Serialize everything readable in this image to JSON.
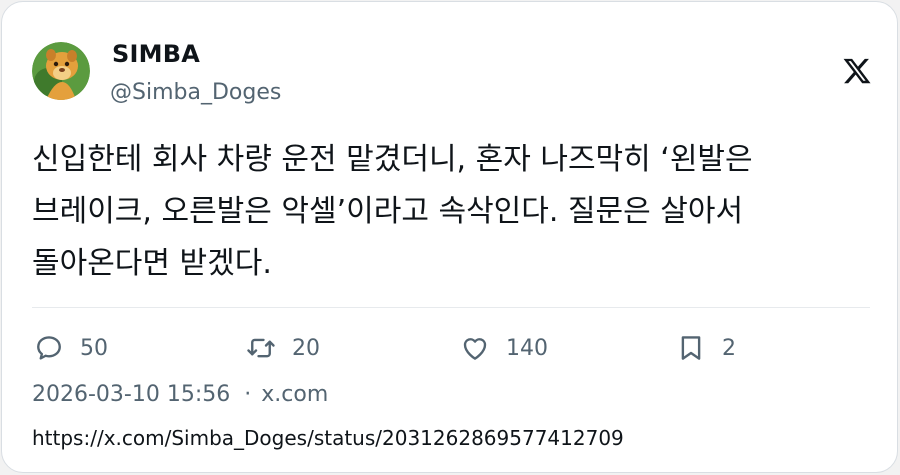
{
  "tweet": {
    "author_name": "SIMBA",
    "author_handle": "@Simba_Doges",
    "text": "신입한테 회사 차량 운전 맡겼더니, 혼자 나즈막히 ‘왼발은\n브레이크, 오른발은 악셀’이라고 속삭인다. 질문은 살아서\n돌아온다면 받겠다.",
    "replies": "50",
    "retweets": "20",
    "likes": "140",
    "bookmarks": "2",
    "timestamp": "2026-03-10 15:56",
    "source": "x.com",
    "url": "https://x.com/Simba_Doges/status/2031262869577412709"
  },
  "icons": {
    "logo": "x-logo-icon",
    "reply": "reply-bubble-icon",
    "retweet": "retweet-icon",
    "like": "heart-icon",
    "bookmark": "bookmark-icon"
  },
  "colors": {
    "text": "#0f1419",
    "secondary": "#536471",
    "divider": "#e7eaed",
    "avatar_bg": "#4a8a3a"
  }
}
